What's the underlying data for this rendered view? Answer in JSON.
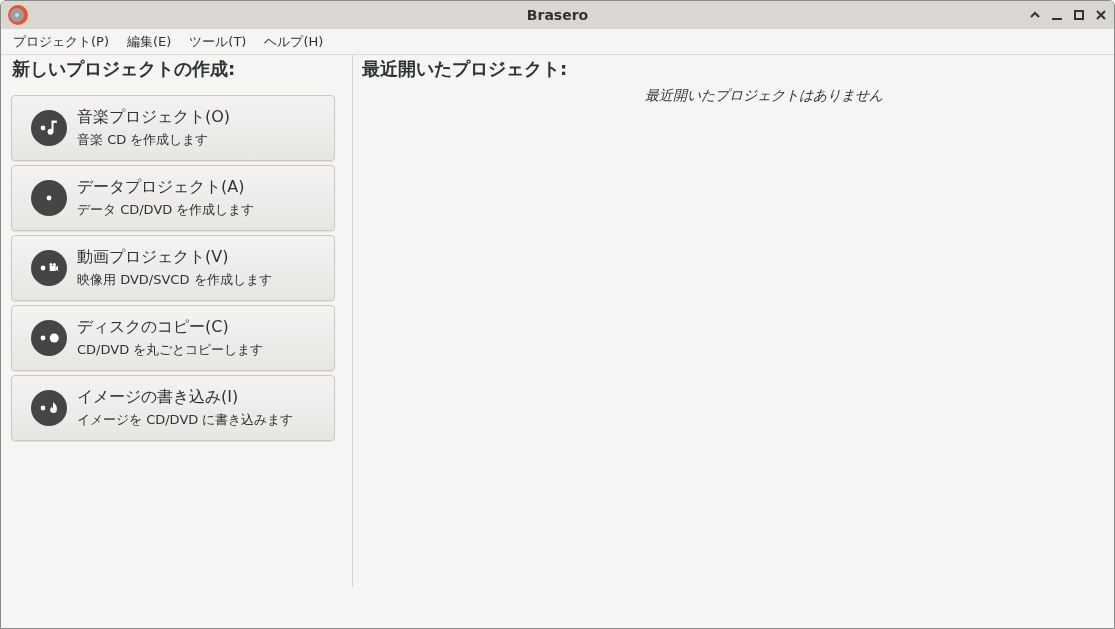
{
  "window": {
    "title": "Brasero"
  },
  "menu": [
    "プロジェクト(P)",
    "編集(E)",
    "ツール(T)",
    "ヘルプ(H)"
  ],
  "new_project": {
    "heading": "新しいプロジェクトの作成:",
    "buttons": [
      {
        "kind": "music",
        "title": "音楽プロジェクト(O)",
        "subtitle": "音楽 CD を作成します"
      },
      {
        "kind": "data",
        "title": "データプロジェクト(A)",
        "subtitle": "データ CD/DVD を作成します"
      },
      {
        "kind": "video",
        "title": "動画プロジェクト(V)",
        "subtitle": "映像用 DVD/SVCD を作成します"
      },
      {
        "kind": "copy",
        "title": "ディスクのコピー(C)",
        "subtitle": "CD/DVD を丸ごとコピーします"
      },
      {
        "kind": "burn",
        "title": "イメージの書き込み(I)",
        "subtitle": "イメージを CD/DVD に書き込みます"
      }
    ]
  },
  "recent": {
    "heading": "最近開いたプロジェクト:",
    "empty_message": "最近開いたプロジェクトはありません"
  }
}
